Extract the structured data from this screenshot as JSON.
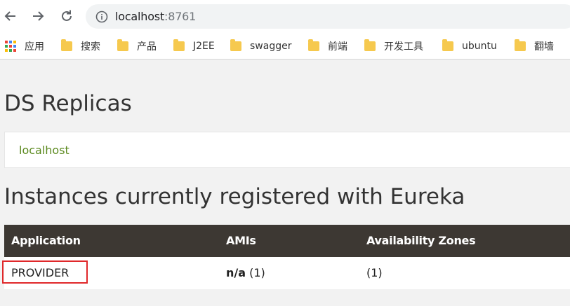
{
  "browser": {
    "url_host": "localhost",
    "url_port": ":8761",
    "bookmarks": [
      {
        "label": "应用",
        "icon": "apps-grid-icon"
      },
      {
        "label": "搜索",
        "icon": "folder-icon"
      },
      {
        "label": "产品",
        "icon": "folder-icon"
      },
      {
        "label": "J2EE",
        "icon": "folder-icon"
      },
      {
        "label": "swagger",
        "icon": "folder-icon"
      },
      {
        "label": "前端",
        "icon": "folder-icon"
      },
      {
        "label": "开发工具",
        "icon": "folder-icon"
      },
      {
        "label": "ubuntu",
        "icon": "folder-icon"
      },
      {
        "label": "翻墙",
        "icon": "folder-icon"
      }
    ]
  },
  "page": {
    "replicas_heading": "DS Replicas",
    "replica_link": "localhost",
    "instances_heading": "Instances currently registered with Eureka",
    "table": {
      "headers": [
        "Application",
        "AMIs",
        "Availability Zones"
      ],
      "rows": [
        {
          "application": "PROVIDER",
          "amis_value": "n/a",
          "amis_count": "(1)",
          "zones": "(1)"
        }
      ]
    }
  },
  "colors": {
    "header_bg": "#3d3833",
    "link_green": "#5c8a1f",
    "highlight_red": "#e0282a",
    "folder_yellow": "#f6c94e"
  }
}
